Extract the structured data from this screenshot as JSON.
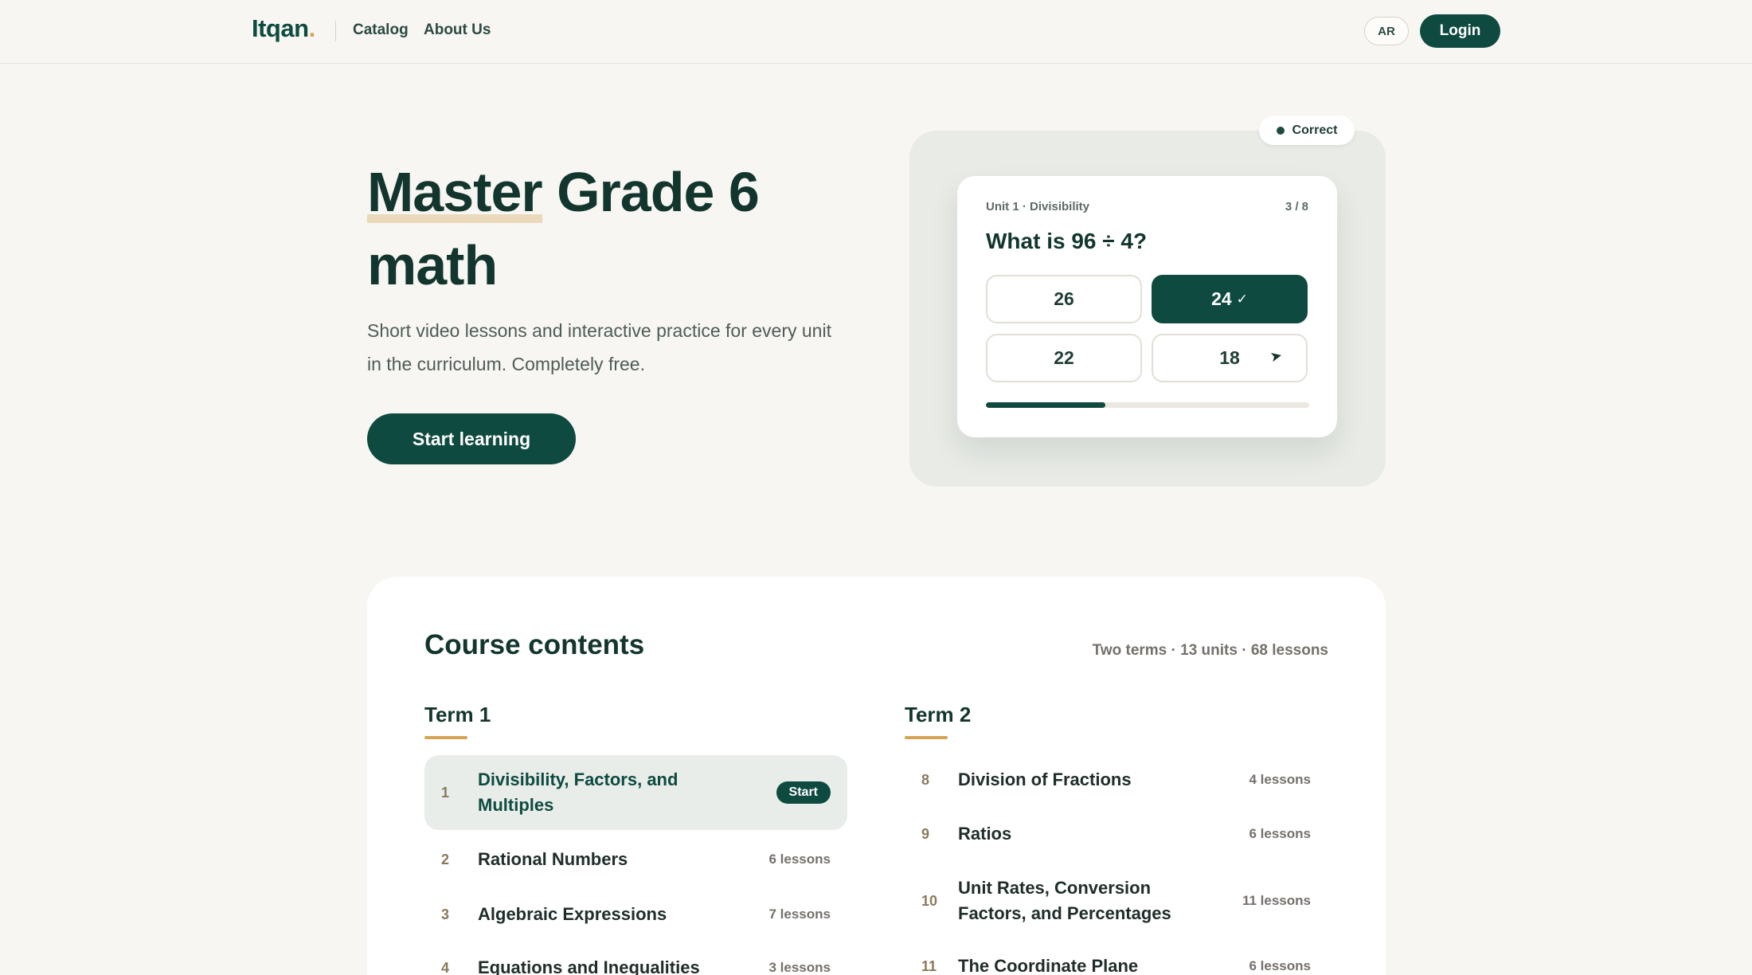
{
  "header": {
    "logo": "Itqan",
    "logo_dot": ".",
    "nav": [
      "Catalog",
      "About Us"
    ],
    "lang_label": "AR",
    "login_label": "Login"
  },
  "hero": {
    "title_highlight": "Master",
    "title_rest": " Grade 6 math",
    "subtitle": "Short video lessons and interactive practice for every unit in the curriculum. Completely free.",
    "cta_label": "Start learning"
  },
  "quiz_preview": {
    "status_label": "Correct",
    "unit_label": "Unit 1 · Divisibility",
    "question_count": "3 / 8",
    "question": "What is 96 ÷ 4?",
    "options": [
      "26",
      "24",
      "22",
      "18"
    ],
    "selected_option": "24",
    "progress": 0.37
  },
  "course": {
    "title": "Course contents",
    "meta": "Two terms · 13 units · 68 lessons",
    "terms": [
      {
        "title": "Term 1",
        "units": [
          {
            "num": "1",
            "name": "Divisibility, Factors, and Multiples",
            "badge": "Start",
            "active": true
          },
          {
            "num": "2",
            "name": "Rational Numbers",
            "lessons": "6 lessons"
          },
          {
            "num": "3",
            "name": "Algebraic Expressions",
            "lessons": "7 lessons"
          },
          {
            "num": "4",
            "name": "Equations and Inequalities",
            "lessons": "3 lessons"
          }
        ]
      },
      {
        "title": "Term 2",
        "units": [
          {
            "num": "8",
            "name": "Division of Fractions",
            "lessons": "4 lessons"
          },
          {
            "num": "9",
            "name": "Ratios",
            "lessons": "6 lessons"
          },
          {
            "num": "10",
            "name": "Unit Rates, Conversion Factors, and Percentages",
            "lessons": "11 lessons"
          },
          {
            "num": "11",
            "name": "The Coordinate Plane",
            "lessons": "6 lessons"
          }
        ]
      }
    ]
  },
  "colors": {
    "brand": "#0e4a40",
    "accent": "#d4a457",
    "background": "#f8f6f2"
  },
  "icons": {
    "check": "check-icon",
    "cursor": "cursor-arrow-icon",
    "status_dot": "status-dot-icon"
  }
}
